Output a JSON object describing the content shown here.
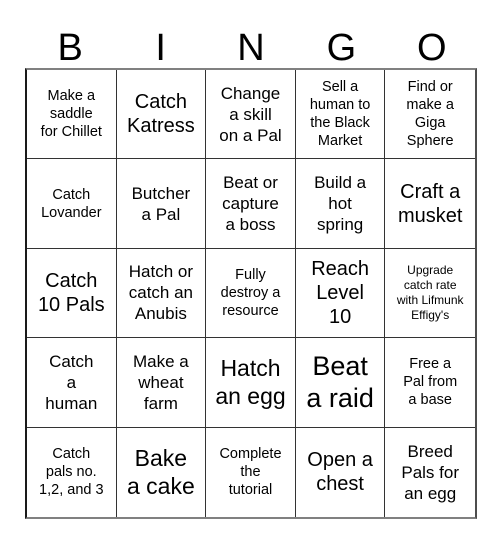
{
  "header": {
    "letters": [
      "B",
      "I",
      "N",
      "G",
      "O"
    ]
  },
  "grid": {
    "rows": 5,
    "columns": 5,
    "border_color": "#333333",
    "background_color": "#ffffff",
    "text_color": "#000000",
    "cells": [
      {
        "text": "Make a\nsaddle\nfor Chillet",
        "size": "s"
      },
      {
        "text": "Catch\nKatress",
        "size": "l"
      },
      {
        "text": "Change\na skill\non a Pal",
        "size": "m"
      },
      {
        "text": "Sell a\nhuman to\nthe Black\nMarket",
        "size": "s"
      },
      {
        "text": "Find or\nmake a\nGiga\nSphere",
        "size": "s"
      },
      {
        "text": "Catch\nLovander",
        "size": "s"
      },
      {
        "text": "Butcher\na Pal",
        "size": "m"
      },
      {
        "text": "Beat or\ncapture\na boss",
        "size": "m"
      },
      {
        "text": "Build a\nhot\nspring",
        "size": "m"
      },
      {
        "text": "Craft a\nmusket",
        "size": "l"
      },
      {
        "text": "Catch\n10 Pals",
        "size": "l"
      },
      {
        "text": "Hatch or\ncatch an\nAnubis",
        "size": "m"
      },
      {
        "text": "Fully\ndestroy a\nresource",
        "size": "s"
      },
      {
        "text": "Reach\nLevel\n10",
        "size": "l"
      },
      {
        "text": "Upgrade\ncatch rate\nwith Lifmunk\nEffigy's",
        "size": "xs"
      },
      {
        "text": "Catch\na\nhuman",
        "size": "m"
      },
      {
        "text": "Make a\nwheat\nfarm",
        "size": "m"
      },
      {
        "text": "Hatch\nan egg",
        "size": "xl"
      },
      {
        "text": "Beat\na raid",
        "size": "xxl"
      },
      {
        "text": "Free a\nPal from\na base",
        "size": "s"
      },
      {
        "text": "Catch\npals no.\n1,2, and 3",
        "size": "s"
      },
      {
        "text": "Bake\na cake",
        "size": "xl"
      },
      {
        "text": "Complete\nthe\ntutorial",
        "size": "s"
      },
      {
        "text": "Open a\nchest",
        "size": "l"
      },
      {
        "text": "Breed\nPals for\nan egg",
        "size": "m"
      }
    ]
  }
}
